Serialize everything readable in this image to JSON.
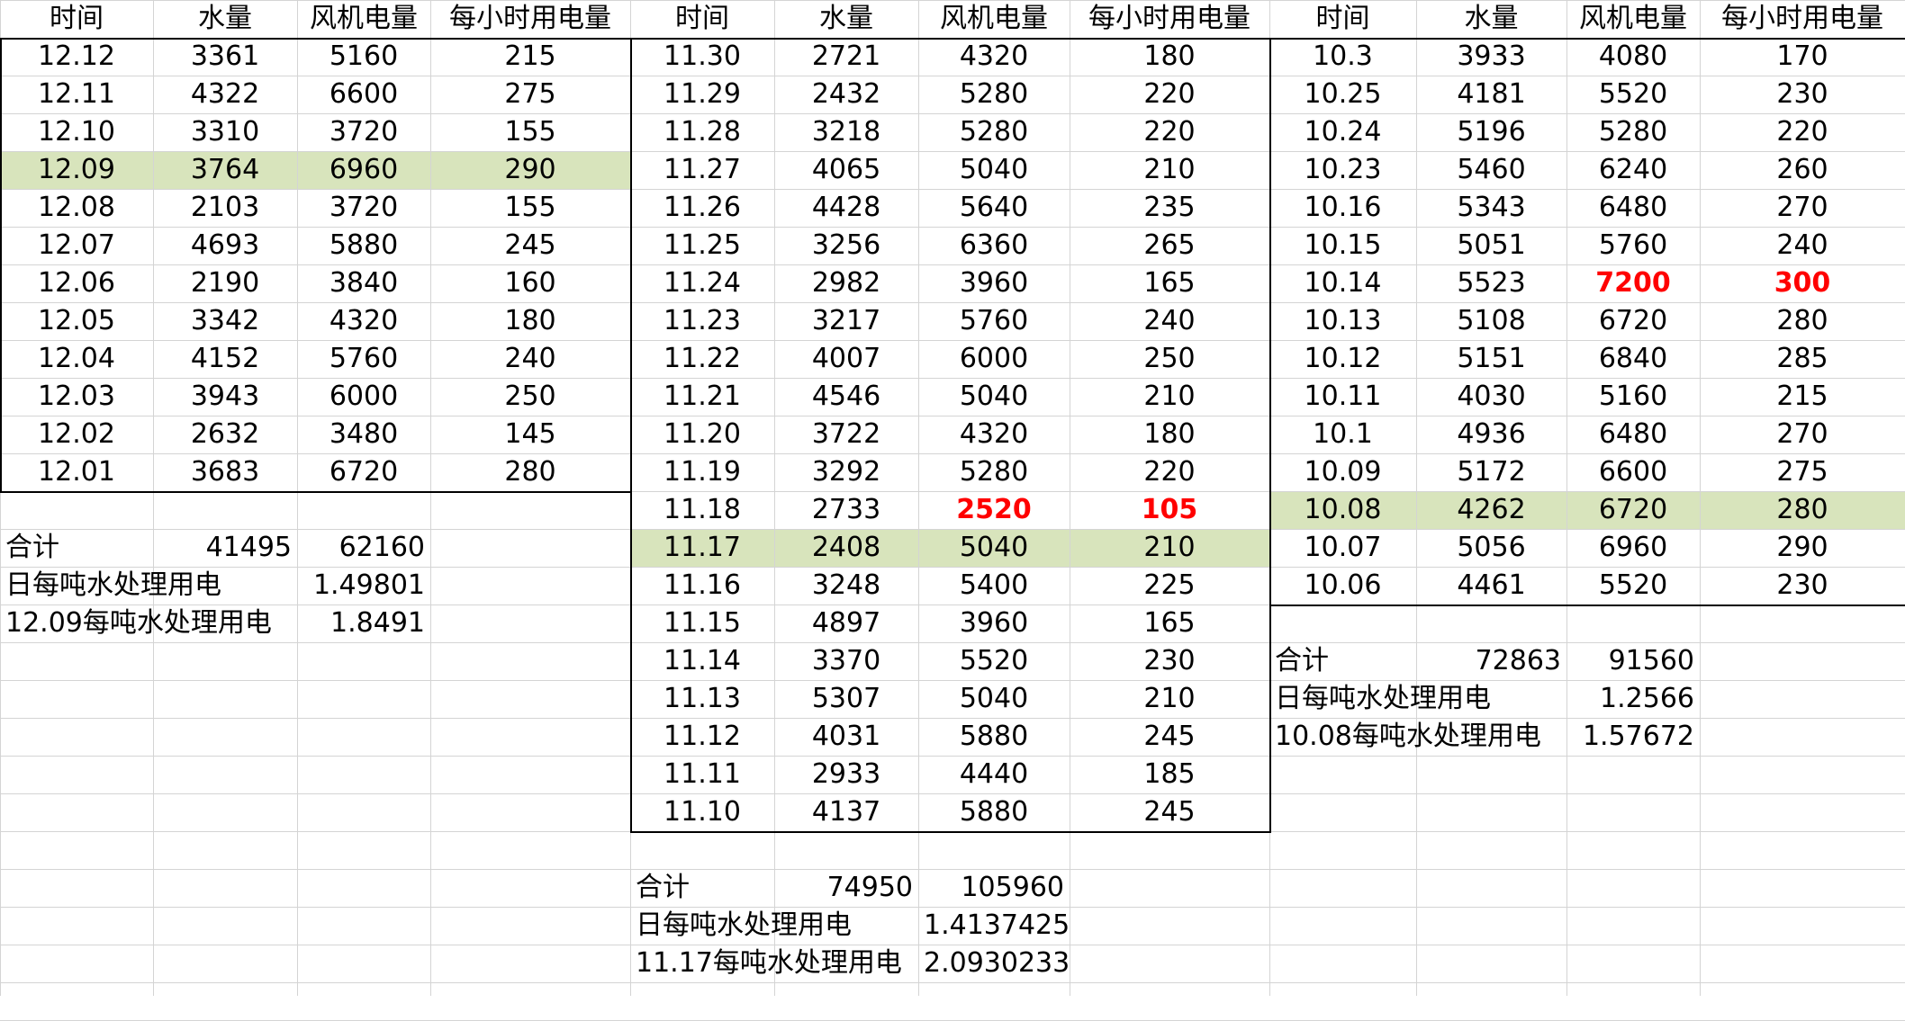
{
  "headers": [
    "时间",
    "水量",
    "风机电量",
    "每小时用电量"
  ],
  "blocks": [
    {
      "rows": [
        [
          "12.12",
          "3361",
          "5160",
          "215"
        ],
        [
          "12.11",
          "4322",
          "6600",
          "275"
        ],
        [
          "12.10",
          "3310",
          "3720",
          "155"
        ],
        [
          "12.09",
          "3764",
          "6960",
          "290"
        ],
        [
          "12.08",
          "2103",
          "3720",
          "155"
        ],
        [
          "12.07",
          "4693",
          "5880",
          "245"
        ],
        [
          "12.06",
          "2190",
          "3840",
          "160"
        ],
        [
          "12.05",
          "3342",
          "4320",
          "180"
        ],
        [
          "12.04",
          "4152",
          "5760",
          "240"
        ],
        [
          "12.03",
          "3943",
          "6000",
          "250"
        ],
        [
          "12.02",
          "2632",
          "3480",
          "145"
        ],
        [
          "12.01",
          "3683",
          "6720",
          "280"
        ]
      ],
      "highlight_row": 3,
      "red_row": null,
      "summary": {
        "total_label": "合计",
        "total_water": "41495",
        "total_power": "62160",
        "daily_label": "日每吨水处理用电",
        "daily_value": "1.49801",
        "special_label": "12.09每吨水处理用电",
        "special_value": "1.8491"
      }
    },
    {
      "rows": [
        [
          "11.30",
          "2721",
          "4320",
          "180"
        ],
        [
          "11.29",
          "2432",
          "5280",
          "220"
        ],
        [
          "11.28",
          "3218",
          "5280",
          "220"
        ],
        [
          "11.27",
          "4065",
          "5040",
          "210"
        ],
        [
          "11.26",
          "4428",
          "5640",
          "235"
        ],
        [
          "11.25",
          "3256",
          "6360",
          "265"
        ],
        [
          "11.24",
          "2982",
          "3960",
          "165"
        ],
        [
          "11.23",
          "3217",
          "5760",
          "240"
        ],
        [
          "11.22",
          "4007",
          "6000",
          "250"
        ],
        [
          "11.21",
          "4546",
          "5040",
          "210"
        ],
        [
          "11.20",
          "3722",
          "4320",
          "180"
        ],
        [
          "11.19",
          "3292",
          "5280",
          "220"
        ],
        [
          "11.18",
          "2733",
          "2520",
          "105"
        ],
        [
          "11.17",
          "2408",
          "5040",
          "210"
        ],
        [
          "11.16",
          "3248",
          "5400",
          "225"
        ],
        [
          "11.15",
          "4897",
          "3960",
          "165"
        ],
        [
          "11.14",
          "3370",
          "5520",
          "230"
        ],
        [
          "11.13",
          "5307",
          "5040",
          "210"
        ],
        [
          "11.12",
          "4031",
          "5880",
          "245"
        ],
        [
          "11.11",
          "2933",
          "4440",
          "185"
        ],
        [
          "11.10",
          "4137",
          "5880",
          "245"
        ]
      ],
      "highlight_row": 13,
      "red_row": 12,
      "summary": {
        "total_label": "合计",
        "total_water": "74950",
        "total_power": "105960",
        "daily_label": "日每吨水处理用电",
        "daily_value": "1.4137425",
        "special_label": "11.17每吨水处理用电",
        "special_value": "2.0930233"
      }
    },
    {
      "rows": [
        [
          "10.3",
          "3933",
          "4080",
          "170"
        ],
        [
          "10.25",
          "4181",
          "5520",
          "230"
        ],
        [
          "10.24",
          "5196",
          "5280",
          "220"
        ],
        [
          "10.23",
          "5460",
          "6240",
          "260"
        ],
        [
          "10.16",
          "5343",
          "6480",
          "270"
        ],
        [
          "10.15",
          "5051",
          "5760",
          "240"
        ],
        [
          "10.14",
          "5523",
          "7200",
          "300"
        ],
        [
          "10.13",
          "5108",
          "6720",
          "280"
        ],
        [
          "10.12",
          "5151",
          "6840",
          "285"
        ],
        [
          "10.11",
          "4030",
          "5160",
          "215"
        ],
        [
          "10.1",
          "4936",
          "6480",
          "270"
        ],
        [
          "10.09",
          "5172",
          "6600",
          "275"
        ],
        [
          "10.08",
          "4262",
          "6720",
          "280"
        ],
        [
          "10.07",
          "5056",
          "6960",
          "290"
        ],
        [
          "10.06",
          "4461",
          "5520",
          "230"
        ]
      ],
      "highlight_row": 12,
      "red_row": 6,
      "summary": {
        "total_label": "合计",
        "total_water": "72863",
        "total_power": "91560",
        "daily_label": "日每吨水处理用电",
        "daily_value": "1.2566",
        "special_label": "10.08每吨水处理用电",
        "special_value": "1.57672"
      }
    }
  ],
  "colors": {
    "highlight": "#d8e4bc",
    "alert": "#ff0000",
    "grid": "#d4d4d4"
  }
}
